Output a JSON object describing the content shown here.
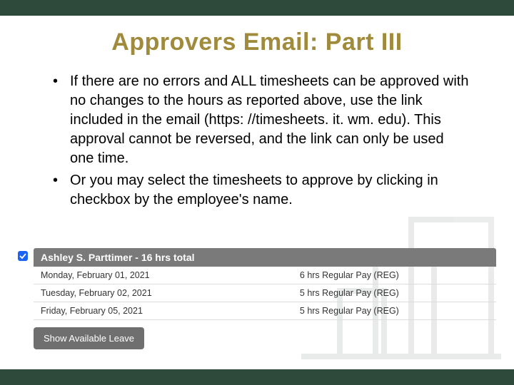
{
  "title": "Approvers Email:  Part III",
  "bullets": [
    "If there are no errors and ALL timesheets can be approved with no changes to the hours as reported above, use the link included in the email (https: //timesheets. it. wm. edu).  This approval cannot be reversed, and the link can only be used one time.",
    "Or you may select the timesheets to approve by clicking in checkbox by the employee's name."
  ],
  "timesheet": {
    "checked": true,
    "header": "Ashley S. Parttimer - 16 hrs total",
    "rows": [
      {
        "date": "Monday, February 01, 2021",
        "hours": "6 hrs Regular Pay (REG)"
      },
      {
        "date": "Tuesday, February 02, 2021",
        "hours": "5 hrs Regular Pay (REG)"
      },
      {
        "date": "Friday, February 05, 2021",
        "hours": "5 hrs Regular Pay (REG)"
      }
    ],
    "leave_button": "Show Available Leave"
  }
}
